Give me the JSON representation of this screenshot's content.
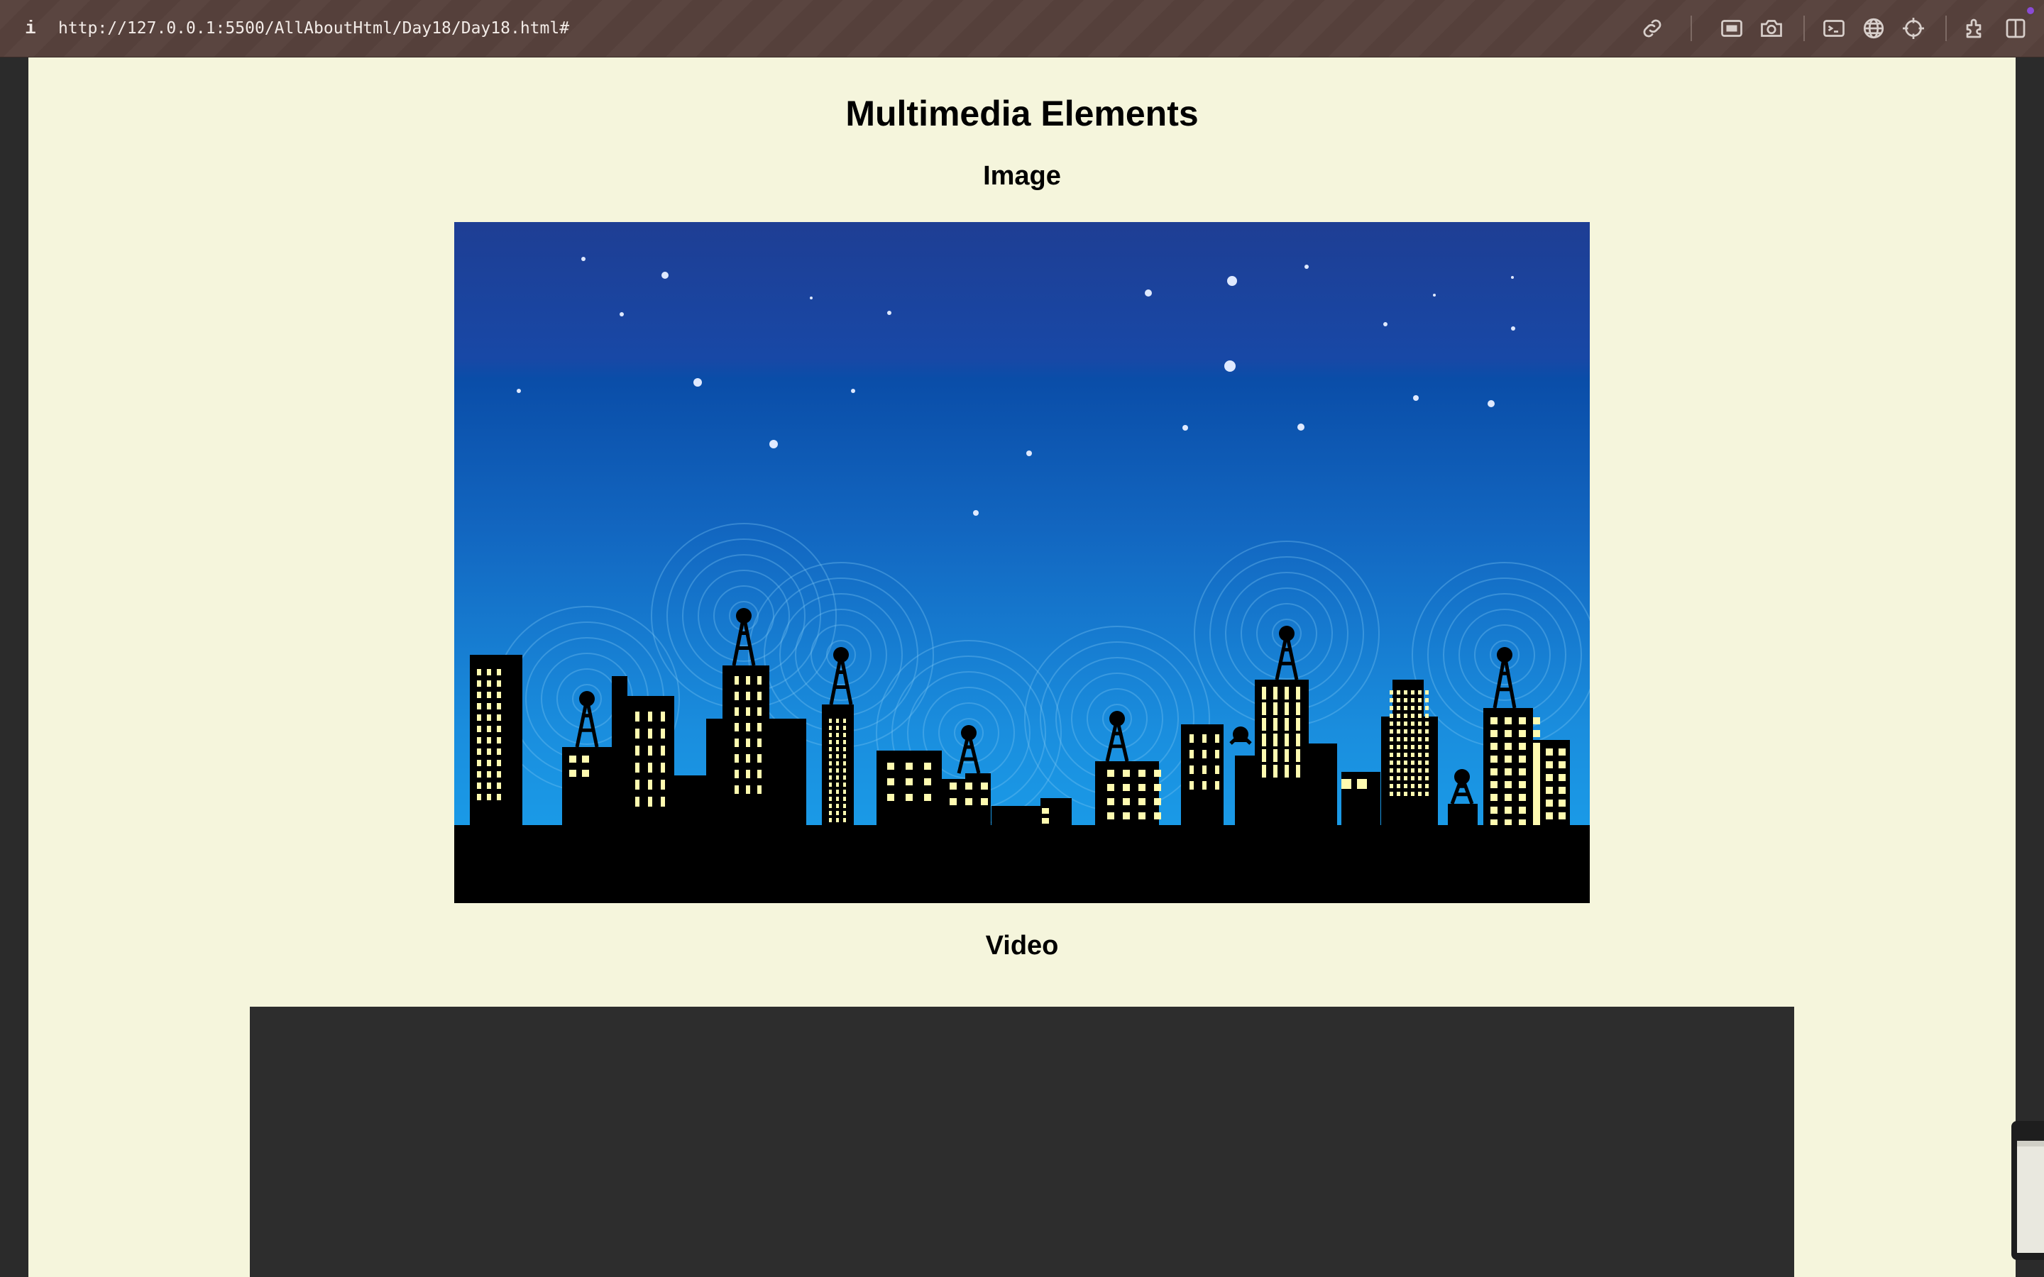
{
  "browser": {
    "info_label": "i",
    "url": "http://127.0.0.1:5500/AllAboutHtml/Day18/Day18.html#",
    "toolbar_icons": [
      "link-icon",
      "capture-area-icon",
      "camera-icon",
      "terminal-icon",
      "globe-icon",
      "crosshair-icon",
      "extensions-icon",
      "sidebar-icon"
    ]
  },
  "page": {
    "title": "Multimedia Elements",
    "image_heading": "Image",
    "video_heading": "Video",
    "background_color": "#f5f5dc"
  },
  "colors": {
    "sky_top": "#1d3f95",
    "sky_bottom": "#1a9be6",
    "window_light": "#fffbb0",
    "video_bg": "#2d2d2d"
  }
}
